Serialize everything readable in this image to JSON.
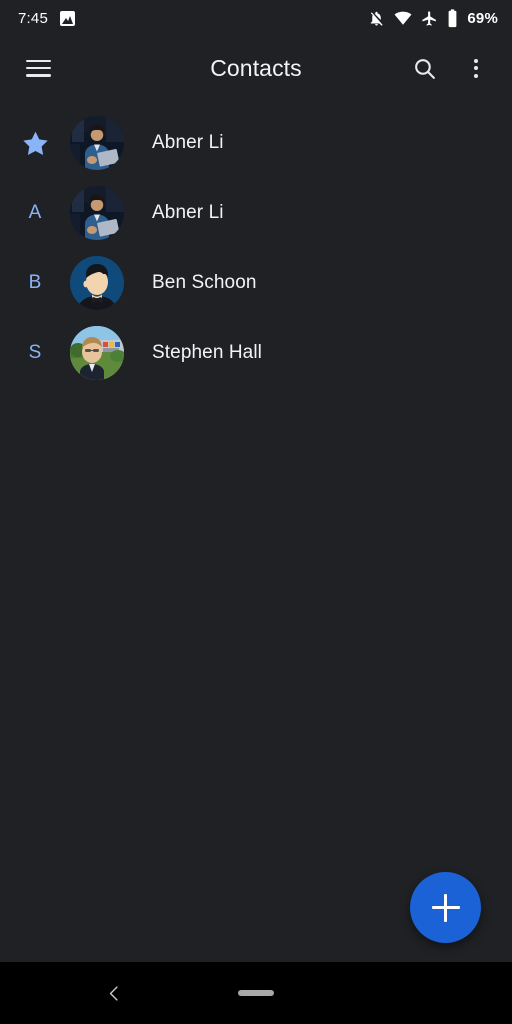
{
  "status_bar": {
    "clock": "7:45",
    "battery_percent": "69%",
    "icons": {
      "photo": "image-icon",
      "notifications_off": "notifications-off-icon",
      "wifi": "wifi-icon",
      "airplane": "airplane-mode-icon",
      "battery": "battery-icon"
    }
  },
  "app_bar": {
    "title": "Contacts",
    "menu_icon": "hamburger-menu-icon",
    "search_icon": "search-icon",
    "overflow_icon": "more-options-icon"
  },
  "contacts": [
    {
      "marker": "★",
      "marker_type": "star",
      "name": "Abner Li",
      "avatar": "photo-person-laptop"
    },
    {
      "marker": "A",
      "marker_type": "letter",
      "name": "Abner Li",
      "avatar": "photo-person-laptop"
    },
    {
      "marker": "B",
      "marker_type": "letter",
      "name": "Ben Schoon",
      "avatar": "illustration-person-blue"
    },
    {
      "marker": "S",
      "marker_type": "letter",
      "name": "Stephen Hall",
      "avatar": "photo-person-outdoors"
    }
  ],
  "fab": {
    "label": "+",
    "icon": "add-icon",
    "color": "#1a62d6"
  },
  "nav_bar": {
    "back_icon": "back-chevron-icon",
    "home_icon": "home-pill-icon"
  },
  "colors": {
    "background": "#1f2124",
    "accent": "#8ab4f8",
    "text": "#f1f3f4",
    "nav_background": "#000000"
  }
}
